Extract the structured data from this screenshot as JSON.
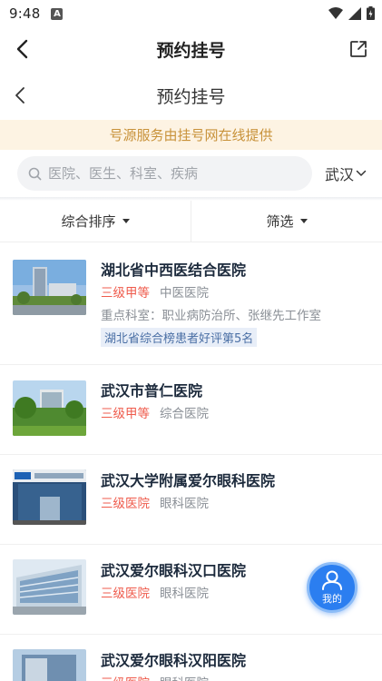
{
  "status": {
    "time": "9:48",
    "notif_letter": "A"
  },
  "appbar": {
    "title": "预约挂号"
  },
  "webbar": {
    "title": "预约挂号"
  },
  "notice": {
    "text": "号源服务由挂号网在线提供"
  },
  "search": {
    "placeholder": "医院、医生、科室、疾病",
    "value": "",
    "city": "武汉"
  },
  "filters": {
    "sort_label": "综合排序",
    "filter_label": "筛选"
  },
  "hospitals": [
    {
      "name": "湖北省中西医结合医院",
      "grade": "三级甲等",
      "type": "中医医院",
      "departments": "重点科室：职业病防治所、张继先工作室",
      "ranking": "湖北省综合榜患者好评第5名"
    },
    {
      "name": "武汉市普仁医院",
      "grade": "三级甲等",
      "type": "综合医院"
    },
    {
      "name": "武汉大学附属爱尔眼科医院",
      "grade": "三级医院",
      "type": "眼科医院"
    },
    {
      "name": "武汉爱尔眼科汉口医院",
      "grade": "三级医院",
      "type": "眼科医院"
    },
    {
      "name": "武汉爱尔眼科汉阳医院",
      "grade": "三级医院",
      "type": "眼科医院"
    }
  ],
  "fab": {
    "label": "我的"
  },
  "colors": {
    "accent": "#2b7ef0",
    "grade_red": "#ef5b4c",
    "notice_bg": "#fdf3e3",
    "notice_text": "#c8923a"
  }
}
